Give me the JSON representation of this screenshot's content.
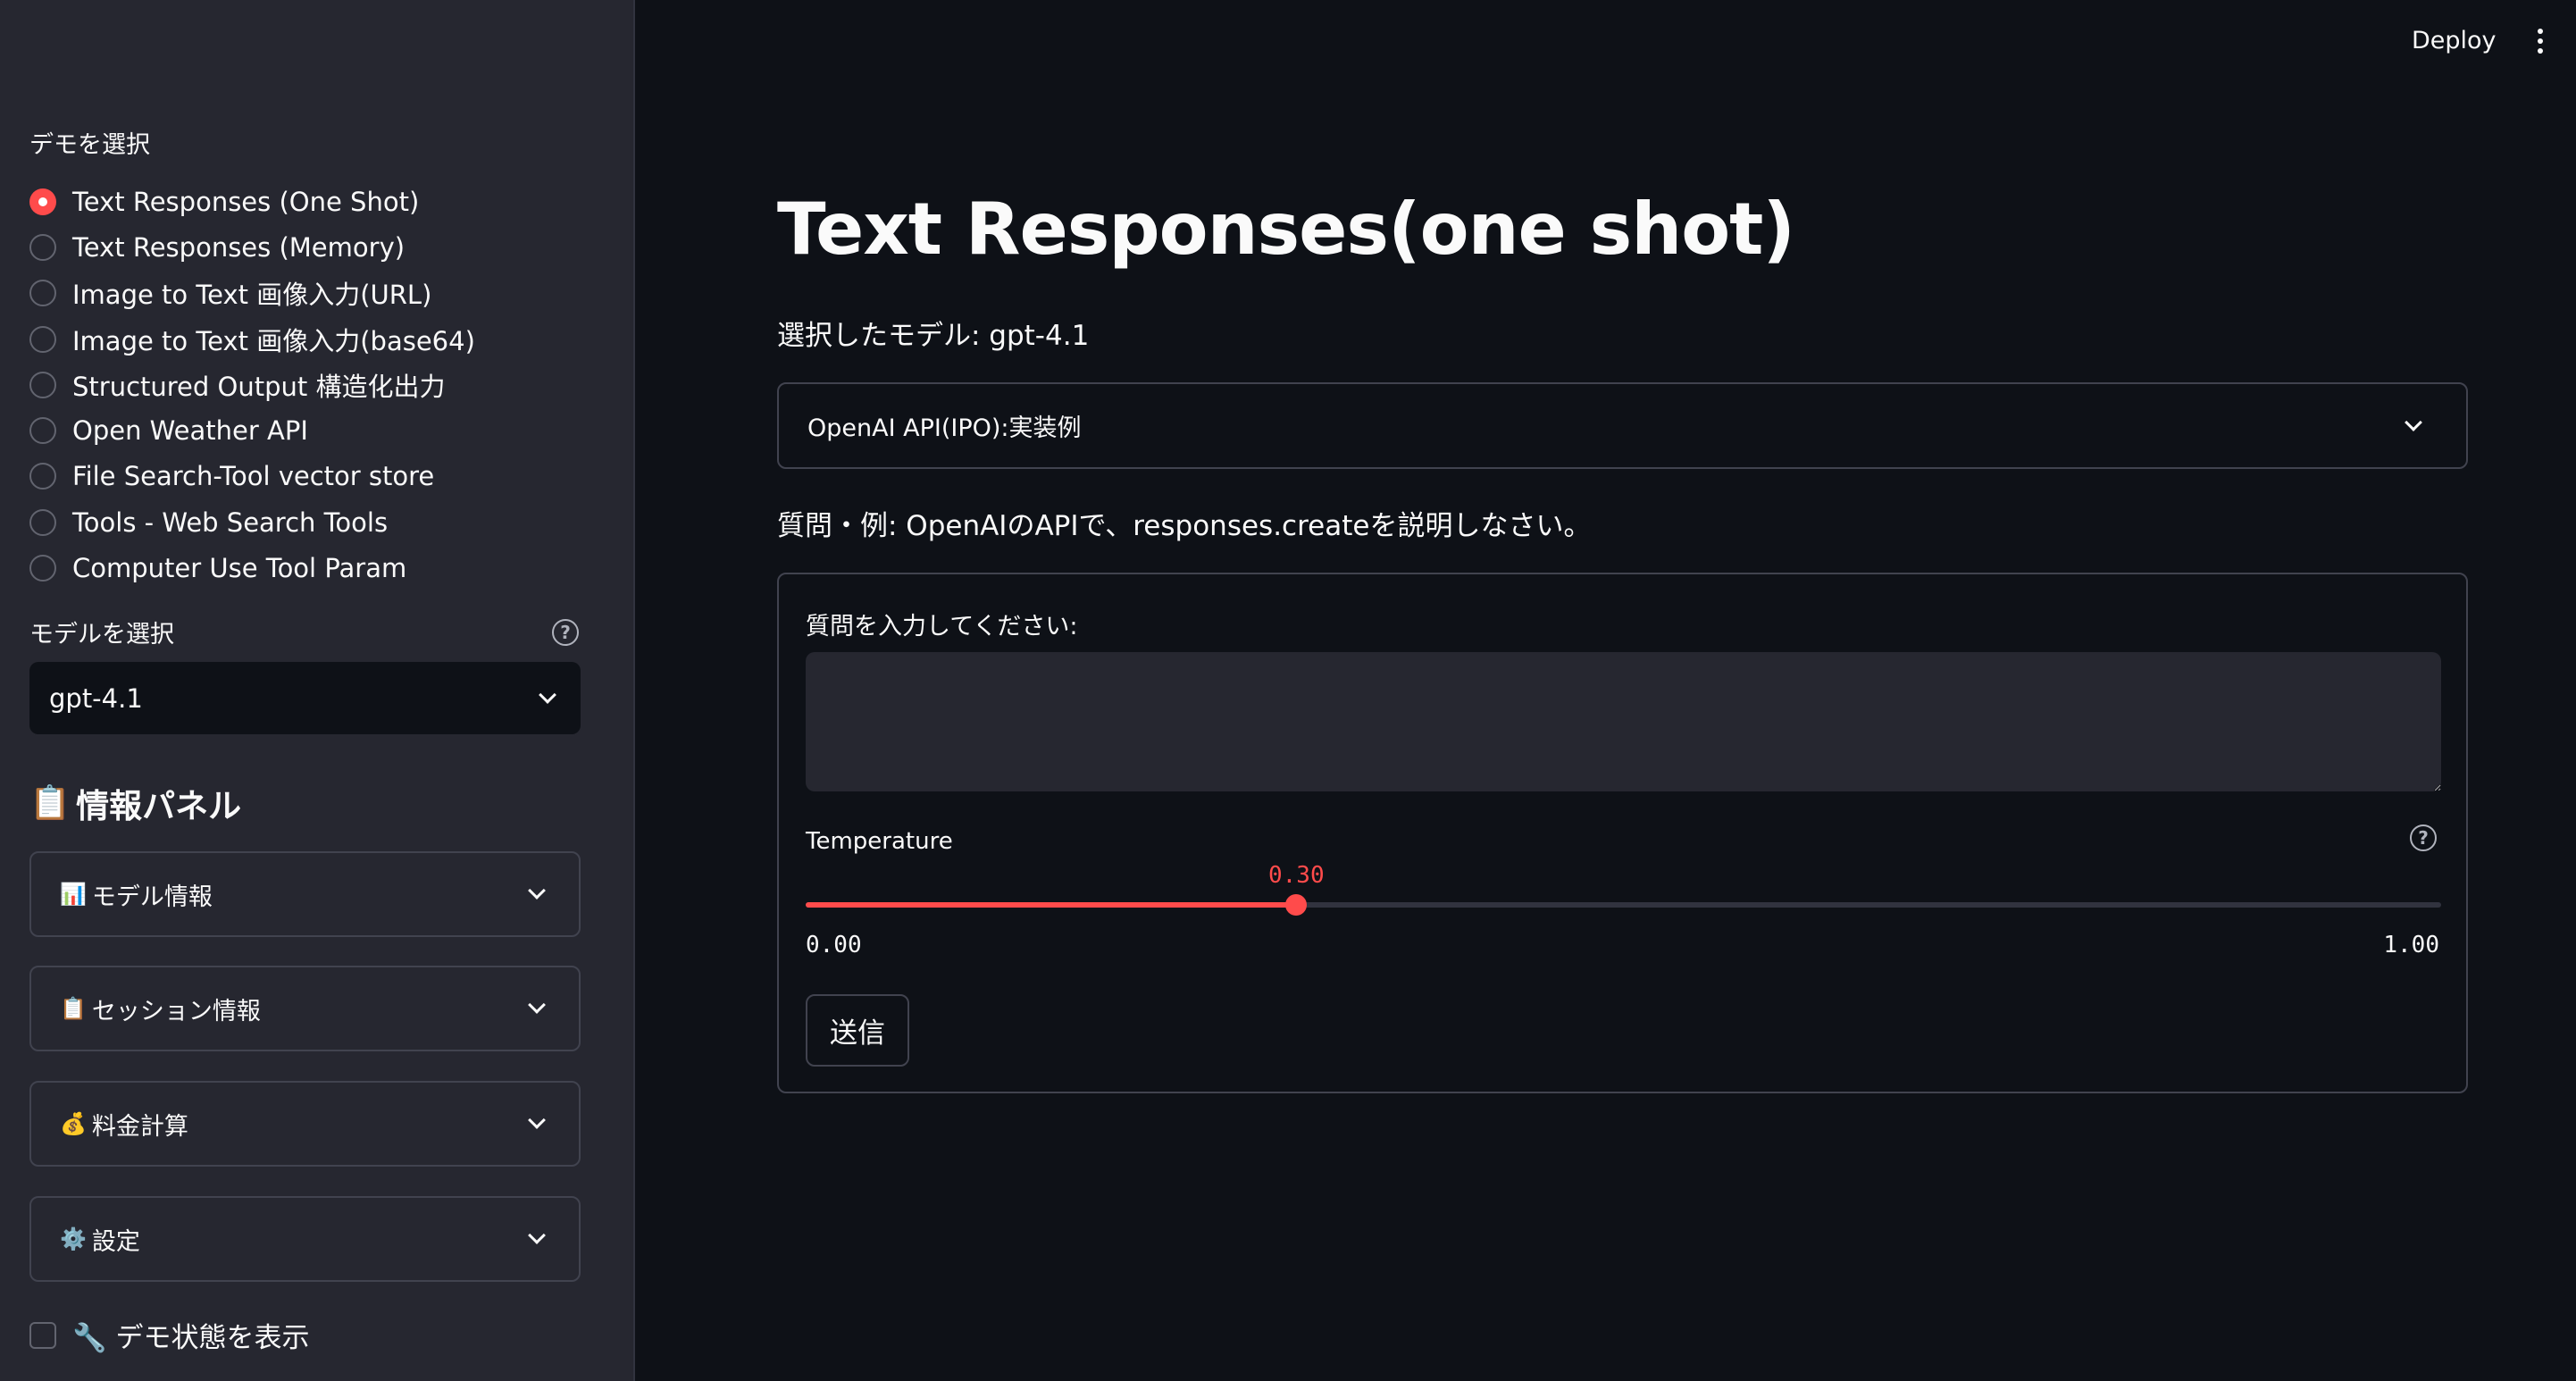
{
  "header": {
    "deploy_label": "Deploy",
    "menu_icon": "kebab-menu-icon"
  },
  "sidebar": {
    "demo_label": "デモを選択",
    "demos": [
      {
        "label": "Text Responses (One Shot)",
        "selected": true
      },
      {
        "label": "Text Responses (Memory)",
        "selected": false
      },
      {
        "label": "Image to Text 画像入力(URL)",
        "selected": false
      },
      {
        "label": "Image to Text 画像入力(base64)",
        "selected": false
      },
      {
        "label": "Structured Output 構造化出力",
        "selected": false
      },
      {
        "label": "Open Weather API",
        "selected": false
      },
      {
        "label": "File Search-Tool vector store",
        "selected": false
      },
      {
        "label": "Tools - Web Search Tools",
        "selected": false
      },
      {
        "label": "Computer Use Tool Param",
        "selected": false
      }
    ],
    "model_label": "モデルを選択",
    "model_value": "gpt-4.1",
    "panel_title": "情報パネル",
    "panel_icon": "📋",
    "expanders": [
      {
        "icon": "📊",
        "label": "モデル情報"
      },
      {
        "icon": "📋",
        "label": "セッション情報"
      },
      {
        "icon": "💰",
        "label": "料金計算"
      },
      {
        "icon": "⚙️",
        "label": "設定"
      }
    ],
    "debug_icon": "🔧",
    "debug_label": "デモ状態を表示",
    "debug_checked": false
  },
  "main": {
    "title": "Text Responses(one shot)",
    "model_line": "選択したモデル: gpt-4.1",
    "api_select_label": "OpenAI API(IPO):実装例",
    "question_example": "質問・例: OpenAIのAPIで、responses.createを説明しなさい。",
    "form": {
      "input_label": "質問を入力してください:",
      "input_value": "",
      "temperature_label": "Temperature",
      "temperature_value": "0.30",
      "temperature_fraction": 0.3,
      "temperature_min": "0.00",
      "temperature_max": "1.00",
      "submit_label": "送信"
    }
  },
  "colors": {
    "accent": "#ff4b4b",
    "background": "#0e1117",
    "sidebar": "#262730"
  }
}
